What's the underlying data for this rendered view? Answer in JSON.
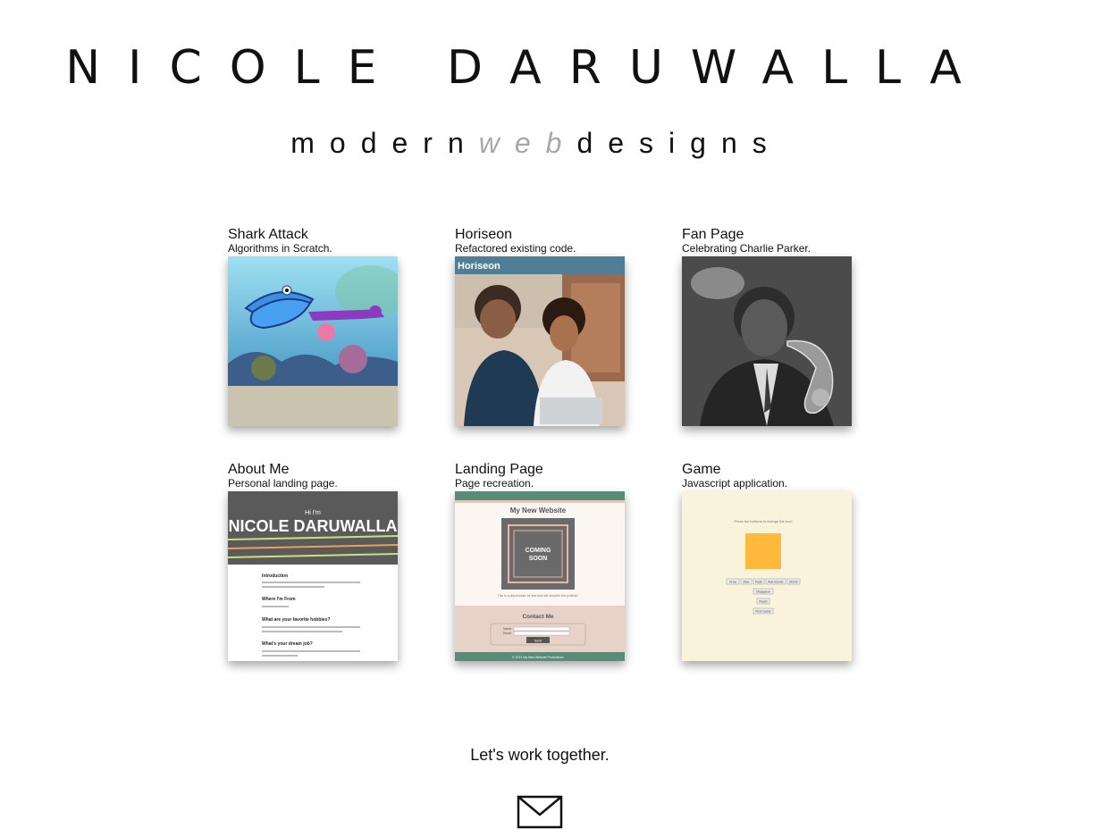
{
  "header": {
    "name": "NICOLE DARUWALLA",
    "tagline_modern": "modern",
    "tagline_web": "web",
    "tagline_designs": "designs"
  },
  "projects": [
    {
      "title": "Shark Attack",
      "description": "Algorithms in Scratch."
    },
    {
      "title": "Horiseon",
      "description": "Refactored existing code.",
      "thumb_text": "Horiseon"
    },
    {
      "title": "Fan Page",
      "description": "Celebrating Charlie Parker."
    },
    {
      "title": "About Me",
      "description": "Personal landing page.",
      "thumb_hi": "Hi I'm",
      "thumb_name": "NICOLE DARUWALLA",
      "thumb_sections": [
        "Introduction",
        "Where I'm From",
        "What are your favorite hobbies?",
        "What's your dream job?"
      ]
    },
    {
      "title": "Landing Page",
      "description": "Page recreation.",
      "thumb_heading": "My New Website",
      "thumb_coming": "COMING",
      "thumb_soon": "SOON",
      "thumb_placeholder": "This is a placeholder for text that will describe the portfolio.",
      "thumb_contact": "Contact Me",
      "thumb_name_label": "Name:",
      "thumb_email_label": "Email:",
      "thumb_send": "Send",
      "thumb_footer": "© 2021 My New Website Productions"
    },
    {
      "title": "Game",
      "description": "Javascript application.",
      "thumb_prompt": "Press the buttons to change the box!",
      "thumb_buttons": [
        "Grow",
        "Blue",
        "Fade",
        "Add Border",
        "Shrink"
      ],
      "thumb_disappear": "Disappear",
      "thumb_reset": "Reset",
      "thumb_find": "Find Game"
    }
  ],
  "footer": {
    "cta": "Let's work together."
  },
  "colors": {
    "tagline_web": "#a8a8a8",
    "game_box": "#ffb93c",
    "landing_green": "#5a8a78"
  }
}
